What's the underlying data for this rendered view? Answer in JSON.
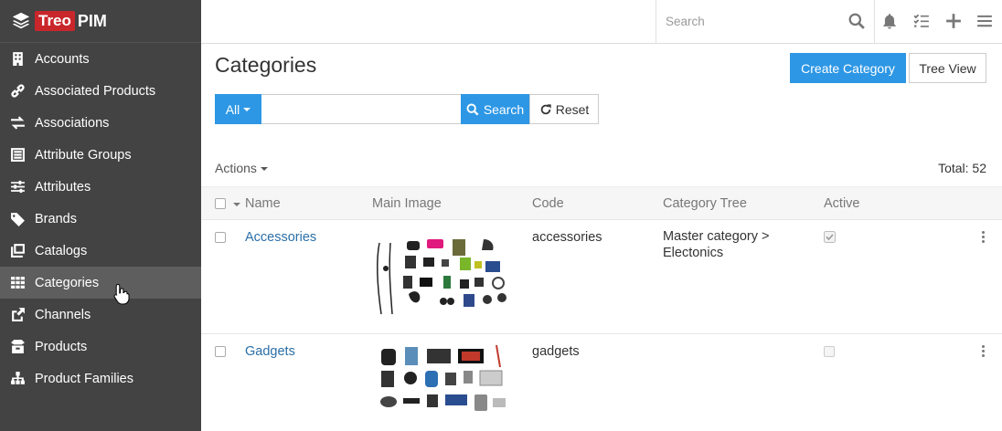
{
  "brand": {
    "treo": "Treo",
    "pim": "PIM"
  },
  "sidebar": {
    "items": [
      {
        "label": "Accounts",
        "icon": "building-icon"
      },
      {
        "label": "Associated Products",
        "icon": "link-icon"
      },
      {
        "label": "Associations",
        "icon": "exchange-icon"
      },
      {
        "label": "Attribute Groups",
        "icon": "attribute-group-icon"
      },
      {
        "label": "Attributes",
        "icon": "sliders-icon"
      },
      {
        "label": "Brands",
        "icon": "tags-icon"
      },
      {
        "label": "Catalogs",
        "icon": "windows-icon"
      },
      {
        "label": "Categories",
        "icon": "grid-icon",
        "active": true
      },
      {
        "label": "Channels",
        "icon": "share-icon"
      },
      {
        "label": "Products",
        "icon": "box-icon"
      },
      {
        "label": "Product Families",
        "icon": "sitemap-icon"
      }
    ]
  },
  "topbar": {
    "search_placeholder": "Search"
  },
  "main": {
    "title": "Categories",
    "create_label": "Create Category",
    "tree_view_label": "Tree View",
    "filter": {
      "all_label": "All",
      "search_label": "Search",
      "reset_label": "Reset"
    },
    "actions_label": "Actions",
    "total_label": "Total: 52"
  },
  "table": {
    "headers": [
      "Name",
      "Main Image",
      "Code",
      "Category Tree",
      "Active"
    ],
    "rows": [
      {
        "name": "Accessories",
        "code": "accessories",
        "tree_line1": "Master category >",
        "tree_line2": "Electonics",
        "active": true
      },
      {
        "name": "Gadgets",
        "code": "gadgets",
        "tree_line1": "",
        "tree_line2": "",
        "active": false
      }
    ]
  },
  "colors": {
    "sidebar_bg": "#434343",
    "accent": "#2d97e5",
    "brand_red": "#c9262c",
    "link": "#2a6fa8"
  }
}
